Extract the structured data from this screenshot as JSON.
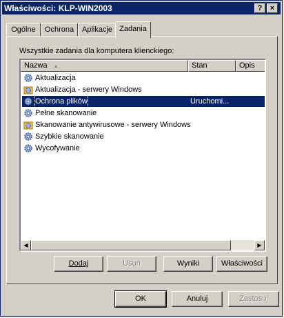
{
  "window": {
    "title": "Właściwości: KLP-WIN2003",
    "help_glyph": "?",
    "close_glyph": "×"
  },
  "tabs": [
    {
      "label": "Ogólne"
    },
    {
      "label": "Ochrona"
    },
    {
      "label": "Aplikacje"
    },
    {
      "label": "Zadania"
    }
  ],
  "panel": {
    "caption": "Wszystkie zadania dla komputera klienckiego:"
  },
  "list": {
    "columns": [
      "Nazwa",
      "Stan",
      "Opis"
    ],
    "sort_glyph": "▲",
    "rows": [
      {
        "name": "Aktualizacja",
        "state": "",
        "icon": "gear-icon"
      },
      {
        "name": "Aktualizacja - serwery Windows",
        "state": "",
        "icon": "gear-folder-icon"
      },
      {
        "name": "Ochrona plików",
        "state": "Uruchomi...",
        "icon": "gear-icon"
      },
      {
        "name": "Pełne skanowanie",
        "state": "",
        "icon": "gear-icon"
      },
      {
        "name": "Skanowanie antywirusowe - serwery Windows",
        "state": "",
        "icon": "gear-folder-icon"
      },
      {
        "name": "Szybkie skanowanie",
        "state": "",
        "icon": "gear-icon"
      },
      {
        "name": "Wycofywanie",
        "state": "",
        "icon": "gear-icon"
      }
    ],
    "selected_index": 2,
    "scroll_left": "◀",
    "scroll_right": "▶"
  },
  "panel_buttons": {
    "add": "Dodaj",
    "remove": "Usuń",
    "results": "Wyniki",
    "properties": "Właściwości"
  },
  "dialog_buttons": {
    "ok": "OK",
    "cancel": "Anuluj",
    "apply": "Zastosuj"
  }
}
